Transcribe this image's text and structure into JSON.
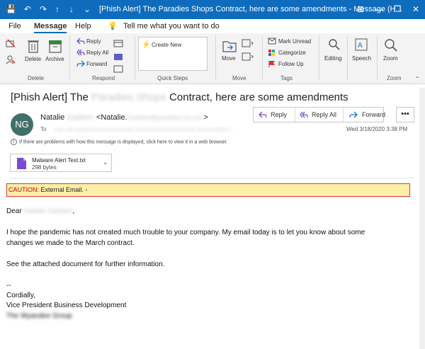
{
  "titlebar": {
    "title": "[Phish Alert] The Paradies Shops Contract, here are some amendments  -  Message (H...",
    "quick_access": {
      "save": "💾",
      "undo": "↶",
      "redo": "↷",
      "up": "↑",
      "down": "↓",
      "more": "⌄"
    },
    "controls": {
      "ribbon_options": "⊞",
      "minimize": "—",
      "restore": "❐",
      "close": "✕"
    }
  },
  "menubar": {
    "file": "File",
    "message": "Message",
    "help": "Help",
    "lightbulb": "💡",
    "tell_me": "Tell me what you want to do"
  },
  "ribbon": {
    "delete_group": {
      "label": "Delete",
      "delete": "Delete",
      "archive": "Archive"
    },
    "respond_group": {
      "label": "Respond",
      "reply": "Reply",
      "reply_all": "Reply All",
      "forward": "Forward"
    },
    "quick_steps_group": {
      "label": "Quick Steps",
      "create_new": "Create New"
    },
    "move_group": {
      "label": "Move",
      "move": "Move"
    },
    "tags_group": {
      "label": "Tags",
      "mark_unread": "Mark Unread",
      "categorize": "Categorize",
      "follow_up": "Follow Up"
    },
    "editing": "Editing",
    "speech": "Speech",
    "zoom": {
      "button": "Zoom",
      "label": "Zoom"
    }
  },
  "message": {
    "subject_prefix": "[Phish Alert] The",
    "subject_hidden": "Paradies Shops",
    "subject_suffix": "Contract, here are some amendments",
    "avatar_initials": "NG",
    "sender_first": "Natalie",
    "sender_last_hidden": "Gadsen",
    "sender_email_prefix": "<Natalie.",
    "sender_email_hidden": "Gadsen@paradies-na.com",
    "sender_email_suffix": ">",
    "to_label": "To",
    "to_hidden": "Phish Alert; junk@office365.microsoft.com; phish@office365.microsoft.com; phishalert@kb4.io",
    "actions": {
      "reply": "Reply",
      "reply_all": "Reply All",
      "forward": "Forward",
      "more": "•••"
    },
    "date": "Wed 3/18/2020 3:38 PM",
    "info_bar": "If there are problems with how this message is displayed, click here to view it in a web browser.",
    "attachment": {
      "name": "Malware Alert Text.txt",
      "size": "298 bytes"
    },
    "caution_label": "CAUTION:",
    "caution_text": " External Email. -",
    "greeting_prefix": "Dear",
    "greeting_hidden": "Natalie Gadsen",
    "greeting_suffix": ",",
    "para1_line1": "I hope the pandemic has not created much trouble to your company. My email today is to let you know about some",
    "para1_line2": "changes we made to the March contract.",
    "para2": "See the attached document for further information.",
    "sig_dash": "--",
    "sig_cordially": "Cordially,",
    "sig_title": "Vice President Business Development",
    "sig_company_hidden": "The Wyandee Group"
  },
  "colors": {
    "accent": "#0f6cbd",
    "avatar": "#436f6a",
    "caution_bg": "#fcefa8",
    "caution_border": "#e0353a"
  }
}
